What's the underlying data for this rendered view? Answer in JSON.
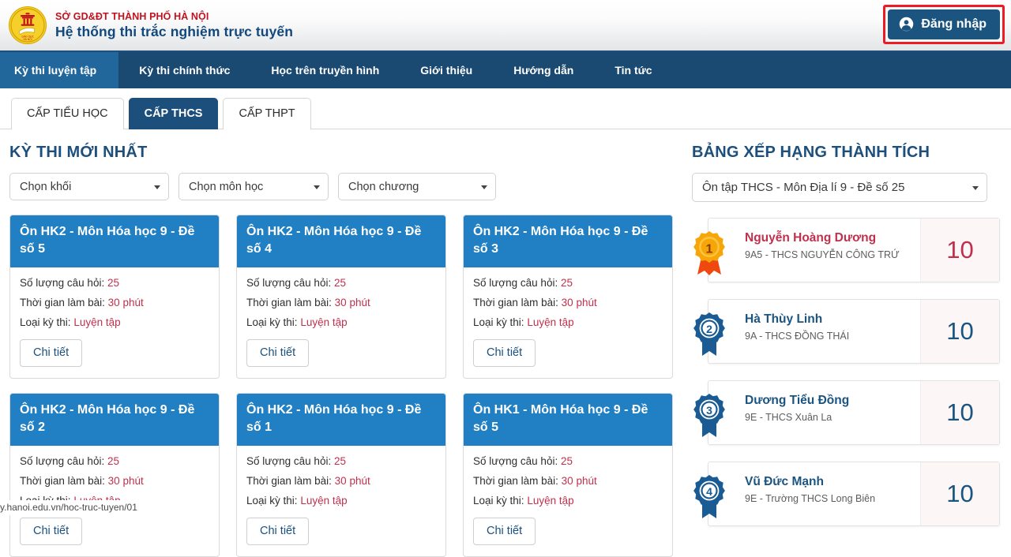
{
  "header": {
    "org_line": "SỞ GD&ĐT THÀNH PHỐ HÀ NỘI",
    "title": "Hệ thống thi trắc nghiệm trực tuyến",
    "logo_icon": "hanoi-education-seal-icon",
    "login_label": "Đăng nhập",
    "login_icon": "user-circle-icon",
    "accent_blue": "#1c5480",
    "accent_red": "#c1121f",
    "highlight_red": "#ee1b24"
  },
  "nav": {
    "items": [
      {
        "label": "Kỳ thi luyện tập",
        "active": true
      },
      {
        "label": "Kỳ thi chính thức",
        "active": false
      },
      {
        "label": "Học trên truyền hình",
        "active": false
      },
      {
        "label": "Giới thiệu",
        "active": false
      },
      {
        "label": "Hướng dẫn",
        "active": false
      },
      {
        "label": "Tin tức",
        "active": false
      }
    ],
    "bar_color": "#1a4a72",
    "active_color": "#22679c"
  },
  "tabs": [
    {
      "label": "CẤP TIỂU HỌC",
      "active": false
    },
    {
      "label": "CẤP THCS",
      "active": true
    },
    {
      "label": "CẤP THPT",
      "active": false
    }
  ],
  "exams_section": {
    "title": "KỲ THI MỚI NHẤT",
    "filters": [
      {
        "value": "Chọn khối",
        "name": "grade"
      },
      {
        "value": "Chọn môn học",
        "name": "subject"
      },
      {
        "value": "Chọn chương",
        "name": "chapter"
      }
    ],
    "labels": {
      "questions": "Số lượng câu hỏi:",
      "duration": "Thời gian làm bài:",
      "type": "Loại kỳ thi:",
      "detail_button": "Chi tiết"
    },
    "cards": [
      {
        "title": "Ôn HK2 - Môn Hóa học 9 - Đề số 5",
        "questions": "25",
        "duration": "30 phút",
        "type": "Luyện tập"
      },
      {
        "title": "Ôn HK2 - Môn Hóa học 9 - Đề số 4",
        "questions": "25",
        "duration": "30 phút",
        "type": "Luyện tập"
      },
      {
        "title": "Ôn HK2 - Môn Hóa học 9 - Đề số 3",
        "questions": "25",
        "duration": "30 phút",
        "type": "Luyện tập"
      },
      {
        "title": "Ôn HK2 - Môn Hóa học 9 - Đề số 2",
        "questions": "25",
        "duration": "30 phút",
        "type": "Luyện tập"
      },
      {
        "title": "Ôn HK2 - Môn Hóa học 9 - Đề số 1",
        "questions": "25",
        "duration": "30 phút",
        "type": "Luyện tập"
      },
      {
        "title": "Ôn HK1 - Môn Hóa học 9 - Đề số 5",
        "questions": "25",
        "duration": "30 phút",
        "type": "Luyện tập"
      }
    ]
  },
  "leaderboard": {
    "title": "BẢNG XẾP HẠNG THÀNH TÍCH",
    "selected_exam": "Ôn tập THCS - Môn Địa lí 9 - Đề số 25",
    "rows": [
      {
        "rank": "1",
        "name": "Nguyễn Hoàng Dương",
        "school": "9A5 - THCS NGUYỄN CÔNG TRỨ",
        "score": "10",
        "style": "gold"
      },
      {
        "rank": "2",
        "name": "Hà Thùy Linh",
        "school": "9A - THCS ĐỒNG THÁI",
        "score": "10",
        "style": "blue"
      },
      {
        "rank": "3",
        "name": "Dương Tiểu Đồng",
        "school": "9E - THCS Xuân La",
        "score": "10",
        "style": "blue"
      },
      {
        "rank": "4",
        "name": "Vũ Đức Mạnh",
        "school": "9E - Trường THCS Long Biên",
        "score": "10",
        "style": "blue"
      }
    ],
    "medal_gold": "#f6a609",
    "medal_blue": "#1a5b93"
  },
  "status_bar": {
    "url": "y.hanoi.edu.vn/hoc-truc-tuyen/01"
  }
}
